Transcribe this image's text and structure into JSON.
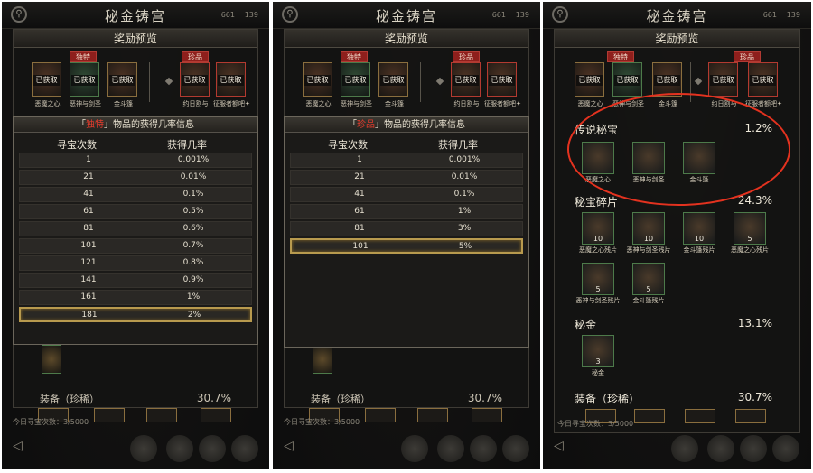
{
  "screen_title": "秘金铸宫",
  "top_stats": [
    "661",
    "139"
  ],
  "reward_preview_title": "奖励预览",
  "tags": {
    "unique": "独特",
    "rare": "珍品"
  },
  "obtained_label": "已获取",
  "preview_items": [
    {
      "name": "恶魔之心"
    },
    {
      "name": "恶神与剑圣"
    },
    {
      "name": "金斗篷"
    },
    {
      "name": "约日割与"
    },
    {
      "name": "征服者额吧✦"
    }
  ],
  "popup1": {
    "title_tag": "独特",
    "title_rest": "物品的获得几率信息",
    "col_count": "寻宝次数",
    "col_rate": "获得几率",
    "rows": [
      {
        "count": "1",
        "rate": "0.001%"
      },
      {
        "count": "21",
        "rate": "0.01%"
      },
      {
        "count": "41",
        "rate": "0.1%"
      },
      {
        "count": "61",
        "rate": "0.5%"
      },
      {
        "count": "81",
        "rate": "0.6%"
      },
      {
        "count": "101",
        "rate": "0.7%"
      },
      {
        "count": "121",
        "rate": "0.8%"
      },
      {
        "count": "141",
        "rate": "0.9%"
      },
      {
        "count": "161",
        "rate": "1%"
      },
      {
        "count": "181",
        "rate": "2%"
      }
    ],
    "selected_index": 9
  },
  "popup2": {
    "title_tag": "珍品",
    "title_rest": "物品的获得几率信息",
    "col_count": "寻宝次数",
    "col_rate": "获得几率",
    "rows": [
      {
        "count": "1",
        "rate": "0.001%"
      },
      {
        "count": "21",
        "rate": "0.01%"
      },
      {
        "count": "41",
        "rate": "0.1%"
      },
      {
        "count": "61",
        "rate": "1%"
      },
      {
        "count": "81",
        "rate": "3%"
      },
      {
        "count": "101",
        "rate": "5%"
      }
    ],
    "selected_index": 5
  },
  "sections": {
    "legendary": {
      "title": "传说秘宝",
      "pct": "1.2%",
      "items": [
        {
          "name": "恶魔之心"
        },
        {
          "name": "恶神与剑圣"
        },
        {
          "name": "金斗篷"
        }
      ]
    },
    "fragments": {
      "title": "秘宝碎片",
      "pct": "24.3%",
      "items": [
        {
          "qty": "10",
          "name": "恶魔之心残片"
        },
        {
          "qty": "10",
          "name": "恶神与剑圣残片"
        },
        {
          "qty": "10",
          "name": "金斗篷残片"
        },
        {
          "qty": "5",
          "name": "恶魔之心残片"
        },
        {
          "qty": "5",
          "name": "恶神与剑圣残片"
        },
        {
          "qty": "5",
          "name": "金斗篷残片"
        }
      ]
    },
    "gold": {
      "title": "秘金",
      "pct": "13.1%",
      "items": [
        {
          "qty": "3",
          "name": "秘金"
        }
      ]
    },
    "equipment": {
      "title": "装备（珍稀）",
      "pct": "30.7%"
    }
  },
  "hunt_count": "今日寻宝次数：3/5000",
  "colors": {
    "accent_gold": "#b89a4e",
    "tag_red": "#8e1f1c",
    "highlight_red": "#e23b2c",
    "annotation": "#e4321f"
  },
  "icons": [
    "back-arrow-icon",
    "compass-icon",
    "relic-icon"
  ]
}
